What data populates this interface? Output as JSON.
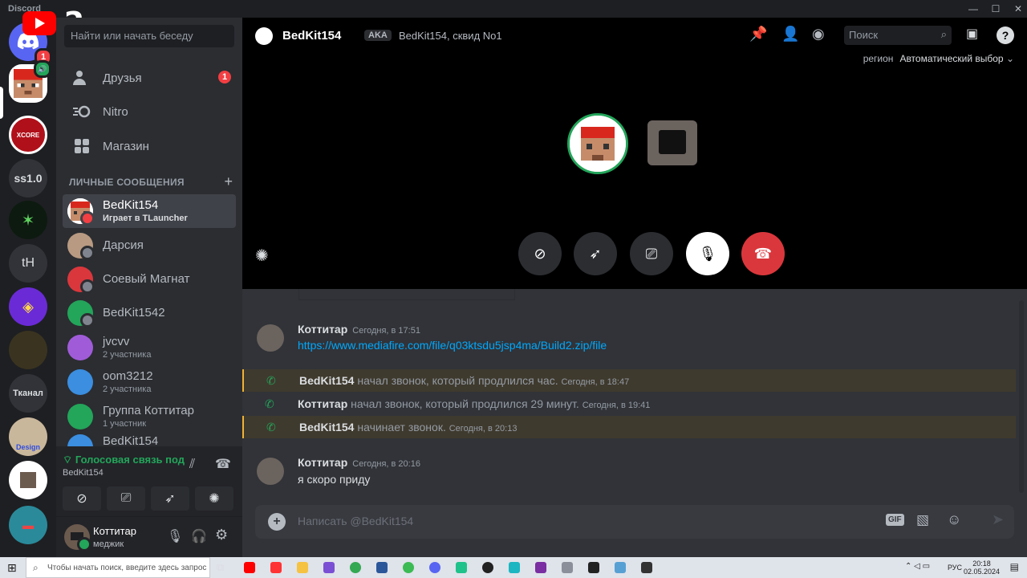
{
  "app": {
    "title": "Discord",
    "yt_overlay_number": "2"
  },
  "window_controls": [
    "—",
    "☐",
    "✕"
  ],
  "guilds": [
    {
      "id": "home",
      "badge": "1"
    },
    {
      "id": "dm-avatar"
    },
    {
      "id": "xcore",
      "label": "XCORE"
    },
    {
      "id": "ss10",
      "label": "ss1.0"
    },
    {
      "id": "green"
    },
    {
      "id": "th",
      "label": "tH"
    },
    {
      "id": "gd"
    },
    {
      "id": "dark"
    },
    {
      "id": "tkanal",
      "label": "Тканал"
    },
    {
      "id": "cat",
      "label": "Design"
    },
    {
      "id": "pair"
    },
    {
      "id": "teal"
    }
  ],
  "sidebar": {
    "search_placeholder": "Найти или начать беседу",
    "nav": [
      {
        "label": "Друзья",
        "badge": "1"
      },
      {
        "label": "Nitro"
      },
      {
        "label": "Магазин"
      }
    ],
    "dm_header": "ЛИЧНЫЕ СООБЩЕНИЯ",
    "dms": [
      {
        "name": "BedKit154",
        "sub": "Играет в TLauncher",
        "active": true
      },
      {
        "name": "Дарсия",
        "sub": ""
      },
      {
        "name": "Соевый Магнат",
        "sub": ""
      },
      {
        "name": "BedKit1542",
        "sub": ""
      },
      {
        "name": "jvcvv",
        "sub": "2 участника"
      },
      {
        "name": "oom3212",
        "sub": "2 участника"
      },
      {
        "name": "Группа Коттитар",
        "sub": "1 участник"
      },
      {
        "name": "BedKit154",
        "sub": ""
      }
    ]
  },
  "voice_panel": {
    "status": "Голосовая связь под",
    "channel": "BedKit154"
  },
  "user_panel": {
    "name": "Коттитар",
    "status": "меджик"
  },
  "header": {
    "name": "BedKit154",
    "aka_tag": "AKA",
    "aka": "BedKit154, сквид No1",
    "search_placeholder": "Поиск"
  },
  "call": {
    "region_label": "регион",
    "region_value": "Автоматический выбор"
  },
  "messages": [
    {
      "author": "Коттитар",
      "time": "Сегодня, в 17:51",
      "text": "https://www.mediafire.com/file/q03ktsdu5jsp4ma/Build2.zip/file",
      "link": true
    },
    {
      "system": true,
      "highlight": true,
      "author": "BedKit154",
      "text": "начал звонок, который продлился час.",
      "time": "Сегодня, в 18:47"
    },
    {
      "system": true,
      "highlight": false,
      "author": "Коттитар",
      "text": "начал звонок, который продлился 29 минут.",
      "time": "Сегодня, в 19:41"
    },
    {
      "system": true,
      "highlight": true,
      "author": "BedKit154",
      "text": "начинает звонок.",
      "time": "Сегодня, в 20:13"
    },
    {
      "author": "Коттитар",
      "time": "Сегодня, в 20:16",
      "text": "я скоро приду"
    }
  ],
  "composer": {
    "placeholder": "Написать @BedKit154",
    "gif": "GIF"
  },
  "taskbar": {
    "search_placeholder": "Чтобы начать поиск, введите здесь запрос",
    "lang": "РУС",
    "time": "20:18",
    "date": "02.05.2024"
  },
  "colors": {
    "accent": "#5865f2",
    "online": "#23a55a",
    "danger": "#da373c",
    "link": "#00a8fc"
  }
}
